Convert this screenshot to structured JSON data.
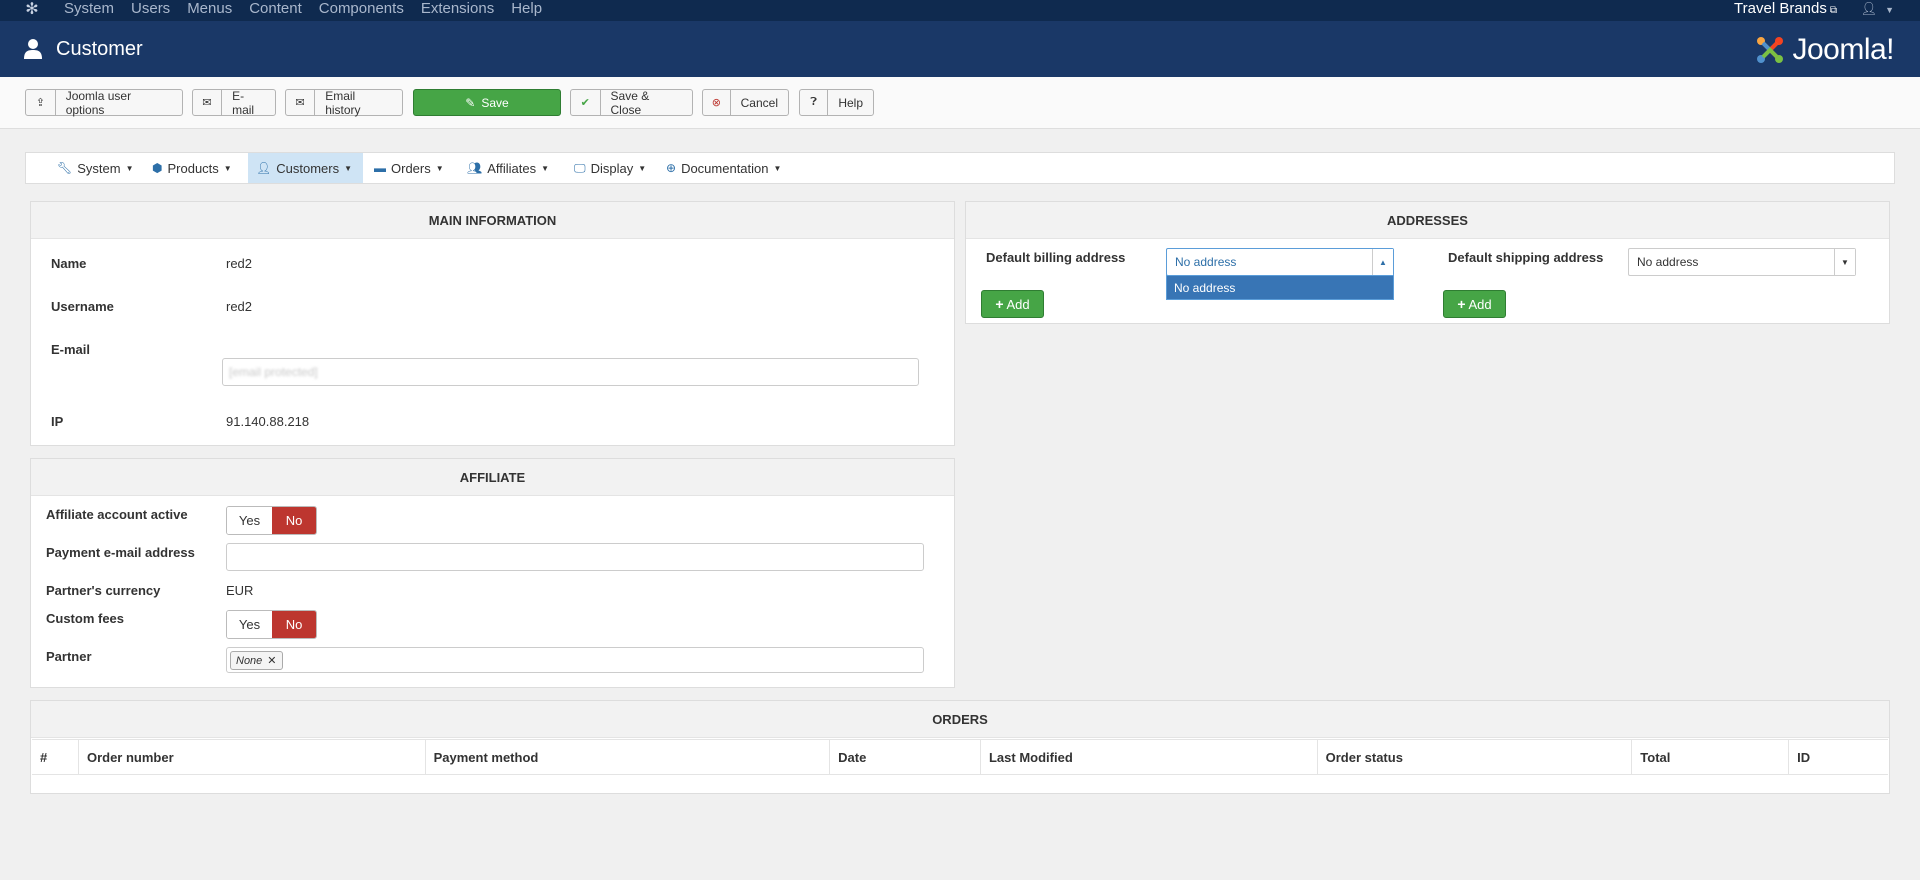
{
  "topnav": {
    "menu": [
      "System",
      "Users",
      "Menus",
      "Content",
      "Components",
      "Extensions",
      "Help"
    ],
    "site_name": "Travel Brands"
  },
  "header": {
    "title": "Customer",
    "logo_text": "Joomla!"
  },
  "toolbar": {
    "joomla_user_options": "Joomla user options",
    "email": "E-mail",
    "email_history": "Email history",
    "save": "Save",
    "save_close": "Save & Close",
    "cancel": "Cancel",
    "help": "Help"
  },
  "component_menu": {
    "items": [
      "System",
      "Products",
      "Customers",
      "Orders",
      "Affiliates",
      "Display",
      "Documentation"
    ],
    "active": "Customers"
  },
  "main_information": {
    "heading": "MAIN INFORMATION",
    "name_label": "Name",
    "name_value": "red2",
    "username_label": "Username",
    "username_value": "red2",
    "email_label": "E-mail",
    "email_value": "[email protected]",
    "ip_label": "IP",
    "ip_value": "91.140.88.218"
  },
  "affiliate": {
    "heading": "AFFILIATE",
    "account_active_label": "Affiliate account active",
    "payment_email_label": "Payment e-mail address",
    "payment_email_value": "",
    "currency_label": "Partner's currency",
    "currency_value": "EUR",
    "custom_fees_label": "Custom fees",
    "partner_label": "Partner",
    "partner_tag": "None",
    "yes": "Yes",
    "no": "No",
    "account_active": false,
    "custom_fees": false
  },
  "addresses": {
    "heading": "ADDRESSES",
    "billing_label": "Default billing address",
    "billing_value": "No address",
    "billing_dropdown_option": "No address",
    "shipping_label": "Default shipping address",
    "shipping_value": "No address",
    "add": "Add"
  },
  "orders": {
    "heading": "ORDERS",
    "columns": [
      "#",
      "Order number",
      "Payment method",
      "Date",
      "Last Modified",
      "Order status",
      "Total",
      "ID"
    ],
    "rows": []
  },
  "colors": {
    "topnav_bg": "#0f2a4f",
    "header_bg": "#1a3867",
    "save_green": "#46a546",
    "no_red": "#bd362f",
    "active_menu": "#cfe4f5",
    "dropdown_highlight": "#3875b5"
  }
}
